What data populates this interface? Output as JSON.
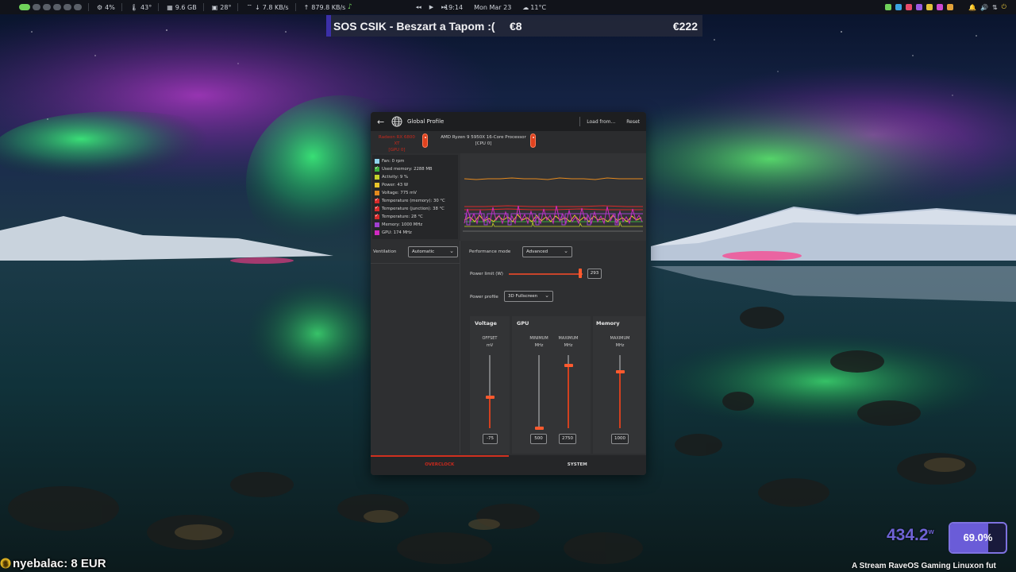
{
  "topbar": {
    "cpu": "4%",
    "cpu_temp": "43°",
    "ram": "9.6 GB",
    "gpu_temp": "28°",
    "net_down": "7.8 KB/s",
    "net_up": "879.8 KB/s",
    "time": "19:14",
    "date": "Mon Mar 23",
    "weather": "11°C"
  },
  "banner": {
    "title": "SOS CSIK - Beszart a Tapom :(",
    "amount_1": "€8",
    "amount_2": "€222"
  },
  "window": {
    "title": "Global Profile",
    "load_label": "Load from...",
    "reset_label": "Reset",
    "devices": {
      "gpu_line1": "Radeon RX 6800 XT",
      "gpu_line2": "[GPU 0]",
      "cpu_line1": "AMD Ryzen 9 5950X 16-Core Processor",
      "cpu_line2": "[CPU 0]"
    },
    "legend": [
      {
        "label": "Fan: 0 rpm",
        "color": "#8fd3ec",
        "checked": false
      },
      {
        "label": "Used memory: 2288 MB",
        "color": "#3cae3a",
        "checked": true
      },
      {
        "label": "Activity: 9 %",
        "color": "#c7d12a",
        "checked": false
      },
      {
        "label": "Power: 43 W",
        "color": "#e9c52a",
        "checked": false
      },
      {
        "label": "Voltage: 775 mV",
        "color": "#e58a1e",
        "checked": false
      },
      {
        "label": "Temperature (memory): 30 °C",
        "color": "#d82a2a",
        "checked": true
      },
      {
        "label": "Temperature (junction): 38 °C",
        "color": "#d82a2a",
        "checked": true
      },
      {
        "label": "Temperature: 28 °C",
        "color": "#d82a2a",
        "checked": true
      },
      {
        "label": "Memory: 1000 MHz",
        "color": "#a040d0",
        "checked": false
      },
      {
        "label": "GPU: 174 MHz",
        "color": "#d02ac0",
        "checked": false
      }
    ],
    "ventilation_label": "Ventilation",
    "ventilation_value": "Automatic",
    "perf_mode_label": "Performance mode",
    "perf_mode_value": "Advanced",
    "power_limit_label": "Power limit (W)",
    "power_limit_value": "293",
    "power_limit_fraction": 0.97,
    "power_profile_label": "Power profile",
    "power_profile_value": "3D Fullscreen",
    "voltage": {
      "title": "Voltage",
      "sub1": "OFFSET",
      "sub2": "mV",
      "value": "-75",
      "fraction": 0.42
    },
    "gpu": {
      "title": "GPU",
      "min_sub1": "MINIMUM",
      "min_sub2": "MHz",
      "min_value": "500",
      "min_fraction": 0.0,
      "max_sub1": "MAXIMUM",
      "max_sub2": "MHz",
      "max_value": "2750",
      "max_fraction": 0.86
    },
    "memory": {
      "title": "Memory",
      "sub1": "MAXIMUM",
      "sub2": "MHz",
      "value": "1000",
      "fraction": 0.77
    },
    "tabs": [
      "OVERCLOCK",
      "SYSTEM"
    ]
  },
  "overlay": {
    "donation_ticker": "nyebalac: 8 EUR",
    "power_value": "434.2",
    "power_unit": "w",
    "percent": "69.0%",
    "percent_fraction": 0.69,
    "scroll_text": "A Stream RaveOS Gaming Linuxon fut"
  }
}
